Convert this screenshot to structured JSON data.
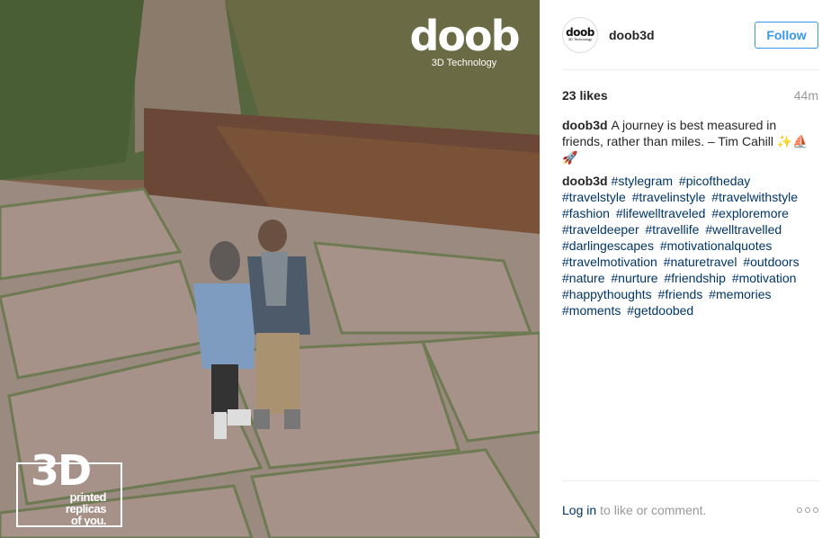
{
  "photo": {
    "brand_word": "doob",
    "brand_sub": "3D Technology",
    "stamp_big": "3D",
    "stamp_lines": [
      "printed",
      "replicas",
      "of you."
    ]
  },
  "post": {
    "username": "doob3d",
    "avatar_word": "doob",
    "avatar_sub": "3D Technology",
    "follow_label": "Follow",
    "likes": "23 likes",
    "time": "44m",
    "caption_author": "doob3d",
    "caption_text": "A journey is best measured in friends, rather than miles. – Tim Cahill ✨⛵ 🚀",
    "comment_author": "doob3d",
    "hashtags": [
      "#stylegram",
      "#picoftheday",
      "#travelstyle",
      "#travelinstyle",
      "#travelwithstyle",
      "#fashion",
      "#lifewelltraveled",
      "#exploremore",
      "#traveldeeper",
      "#travellife",
      "#welltravelled",
      "#darlingescapes",
      "#motivationalquotes",
      "#travelmotivation",
      "#naturetravel",
      "#outdoors",
      "#nature",
      "#nurture",
      "#friendship",
      "#motivation",
      "#happythoughts",
      "#friends",
      "#memories",
      "#moments",
      "#getdoobed"
    ],
    "login_label": "Log in",
    "login_rest": "to like or comment."
  },
  "colors": {
    "link": "#003569",
    "follow": "#3897f0",
    "muted": "#999999"
  },
  "icons": [
    "more-options-icon"
  ]
}
